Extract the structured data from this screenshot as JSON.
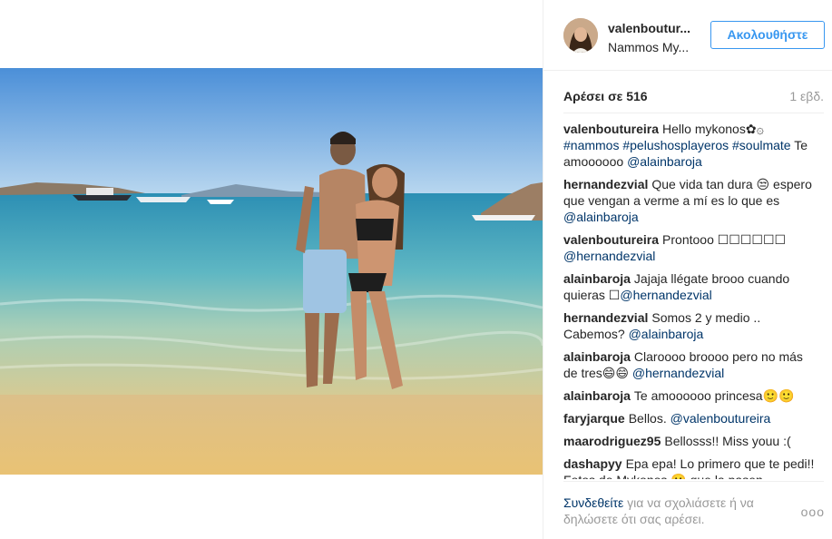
{
  "header": {
    "username": "valenboutur...",
    "location": "Nammos My...",
    "follow_label": "Ακολουθήστε"
  },
  "post": {
    "likes": "Αρέσει σε 516",
    "time": "1 εβδ."
  },
  "comments": [
    {
      "author": "valenboutureira",
      "text": "Hello mykonos✿۞",
      "text2": "",
      "tags": "#nammos #pelushosplayeros #soulmate",
      "text3": "Te amoooooo ",
      "mention": "@alainbaroja"
    },
    {
      "author": "hernandezvial",
      "text": "Que vida tan dura 😒 espero que vengan a verme a mí es lo que es ",
      "mention": "@alainbaroja"
    },
    {
      "author": "valenboutureira",
      "text": "Prontooo ☐☐☐☐☐☐ ",
      "mention": "@hernandezvial"
    },
    {
      "author": "alainbaroja",
      "text": "Jajaja llégate brooo cuando quieras ☐",
      "mention": "@hernandezvial"
    },
    {
      "author": "hernandezvial",
      "text": "Somos 2 y medio .. Cabemos? ",
      "mention": "@alainbaroja"
    },
    {
      "author": "alainbaroja",
      "text": "Claroooo broooo pero no más de tres😄😄 ",
      "mention": "@hernandezvial"
    },
    {
      "author": "alainbaroja",
      "text": "Te amoooooo princesa🙂🙂",
      "mention": ""
    },
    {
      "author": "faryjarque",
      "text": "Bellos. ",
      "mention": "@valenboutureira"
    },
    {
      "author": "maarodriguez95",
      "text": "Bellosss!! Miss youu :(",
      "mention": ""
    },
    {
      "author": "dashapyy",
      "text": "Epa epa! Lo primero que te pedi!! Fotos de Mykonos 🙂 que la pasen",
      "mention": ""
    }
  ],
  "footer": {
    "login_link": "Συνδεθείτε",
    "rest": " για να σχολιάσετε ή να δηλώσετε ότι σας αρέσει.",
    "more": "ooo"
  },
  "colors": {
    "accent": "#3897f0",
    "link": "#003569",
    "muted": "#999999"
  }
}
